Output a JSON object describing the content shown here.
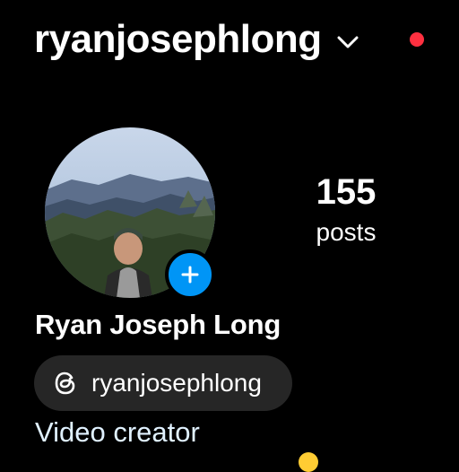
{
  "header": {
    "username": "ryanjosephlong"
  },
  "stats": {
    "posts_count": "155",
    "posts_label": "posts"
  },
  "profile": {
    "full_name": "Ryan Joseph Long",
    "threads_handle": "ryanjosephlong",
    "bio": "Video creator"
  },
  "icons": {
    "chevron": "chevron-down-icon",
    "add": "plus-icon",
    "threads": "threads-icon",
    "notification": "notification-dot"
  },
  "colors": {
    "background": "#000000",
    "accent_blue": "#0095f6",
    "notification_red": "#ff3040",
    "pill_bg": "#262626"
  }
}
